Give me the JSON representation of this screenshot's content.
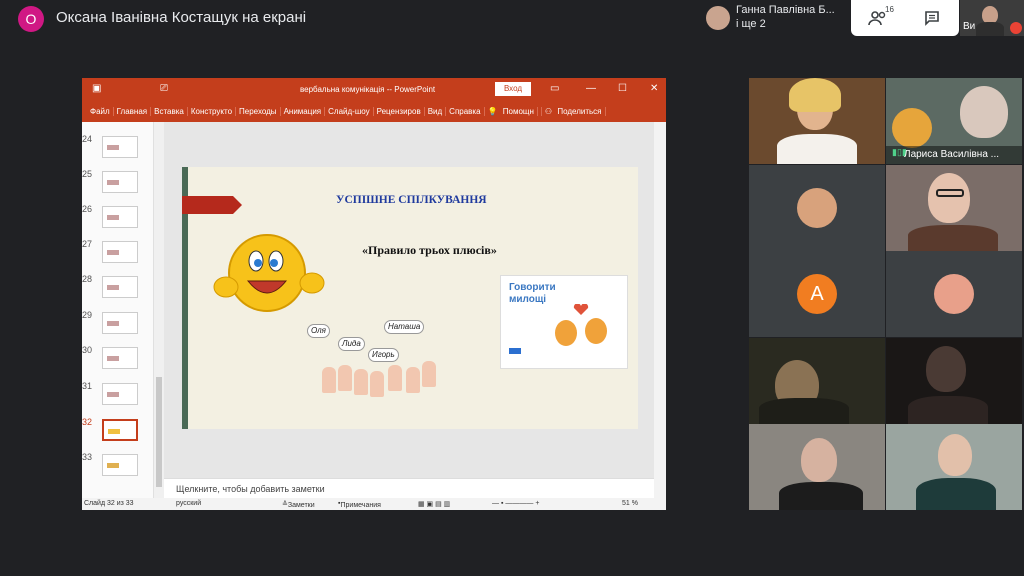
{
  "presenter": {
    "initial": "О",
    "title": "Оксана Іванівна Костащук на екрані"
  },
  "host_chip": {
    "name": "Ганна Павлівна Б...",
    "more": "і ще 2"
  },
  "controls": {
    "participants_count": "16",
    "self_label": "Ви"
  },
  "powerpoint": {
    "window_title": "вербальна комунікація -- PowerPoint",
    "login": "Вход",
    "menu": [
      "Файл",
      "Главная",
      "Вставка",
      "Конструкто",
      "Переходы",
      "Анимация",
      "Слайд-шоу",
      "Рецензиров",
      "Вид",
      "Справка",
      "Помощн",
      "Поделиться"
    ],
    "thumbnails": [
      {
        "num": "24"
      },
      {
        "num": "25"
      },
      {
        "num": "26"
      },
      {
        "num": "27"
      },
      {
        "num": "28"
      },
      {
        "num": "29"
      },
      {
        "num": "30"
      },
      {
        "num": "31"
      },
      {
        "num": "32"
      },
      {
        "num": "33"
      }
    ],
    "slide": {
      "heading": "УСПІШНЕ СПІЛКУВАННЯ",
      "subheading": "«Правило трьох плюсів»",
      "card_text": "Говорити милощі",
      "bubbles": [
        "Оля",
        "Наташа",
        "Лида",
        "Игорь"
      ]
    },
    "notes_placeholder": "Щелкните, чтобы добавить заметки",
    "status": {
      "slide": "Слайд 32 из 33",
      "language": "русский",
      "notes": "Заметки",
      "comments": "Примечания",
      "zoom": "51 %"
    }
  },
  "participants": [
    {
      "name": ""
    },
    {
      "name": "Лариса Василівна ..."
    },
    {
      "name": ""
    },
    {
      "name": ""
    },
    {
      "name": "",
      "letter": "А"
    },
    {
      "name": ""
    },
    {
      "name": ""
    },
    {
      "name": ""
    },
    {
      "name": ""
    },
    {
      "name": ""
    }
  ],
  "colors": {
    "background": "#202124",
    "presenter_avatar": "#d01884",
    "powerpoint_brand": "#c43e1c",
    "avatar_orange": "#f17d21",
    "muted_red": "#ea4335"
  }
}
